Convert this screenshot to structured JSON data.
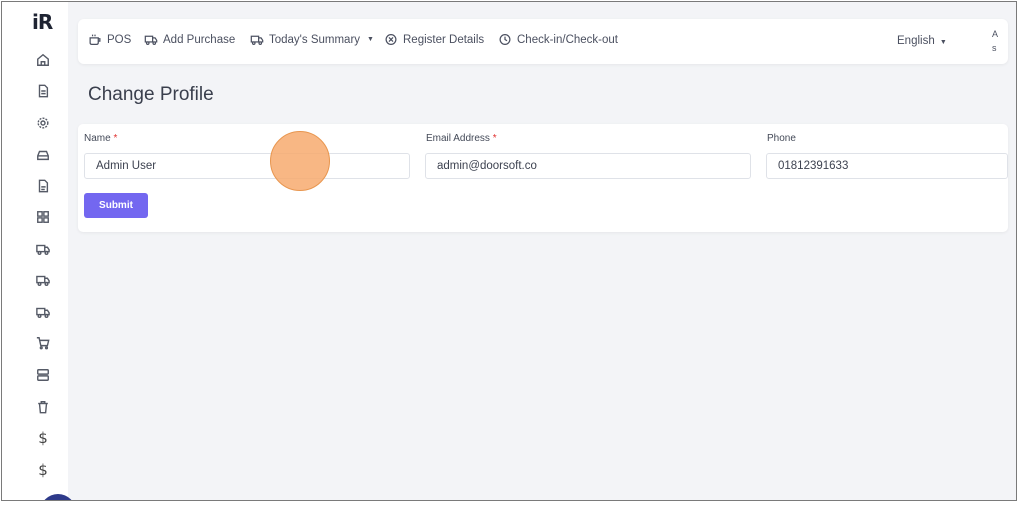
{
  "app": {
    "logo": "iR"
  },
  "sidebar": {
    "icons": [
      "home-icon",
      "document-icon",
      "settings-icon",
      "drive-icon",
      "file-icon",
      "grid-icon",
      "truck-icon",
      "truck-icon",
      "truck-icon",
      "cart-icon",
      "server-icon",
      "trash-icon",
      "dollar-icon",
      "dollar-icon"
    ],
    "dollar_symbol": "$"
  },
  "topbar": {
    "nav": [
      {
        "label": "POS",
        "icon": "coffee-icon"
      },
      {
        "label": "Add Purchase",
        "icon": "truck-icon"
      },
      {
        "label": "Today's Summary",
        "icon": "truck-icon",
        "dropdown": true
      },
      {
        "label": "Register Details",
        "icon": "close-circle-icon"
      },
      {
        "label": "Check-in/Check-out",
        "icon": "clock-icon"
      }
    ],
    "language": "English",
    "corner_line1": "A",
    "corner_line2": "s"
  },
  "page": {
    "title": "Change Profile"
  },
  "form": {
    "name_label": "Name",
    "name_value": "Admin User",
    "email_label": "Email Address",
    "email_value": "admin@doorsoft.co",
    "phone_label": "Phone",
    "phone_value": "01812391633",
    "required_mark": "*",
    "submit_label": "Submit"
  },
  "colors": {
    "accent": "#7367f0",
    "required": "#e0302f",
    "click_indicator": "#f7aa6e"
  }
}
